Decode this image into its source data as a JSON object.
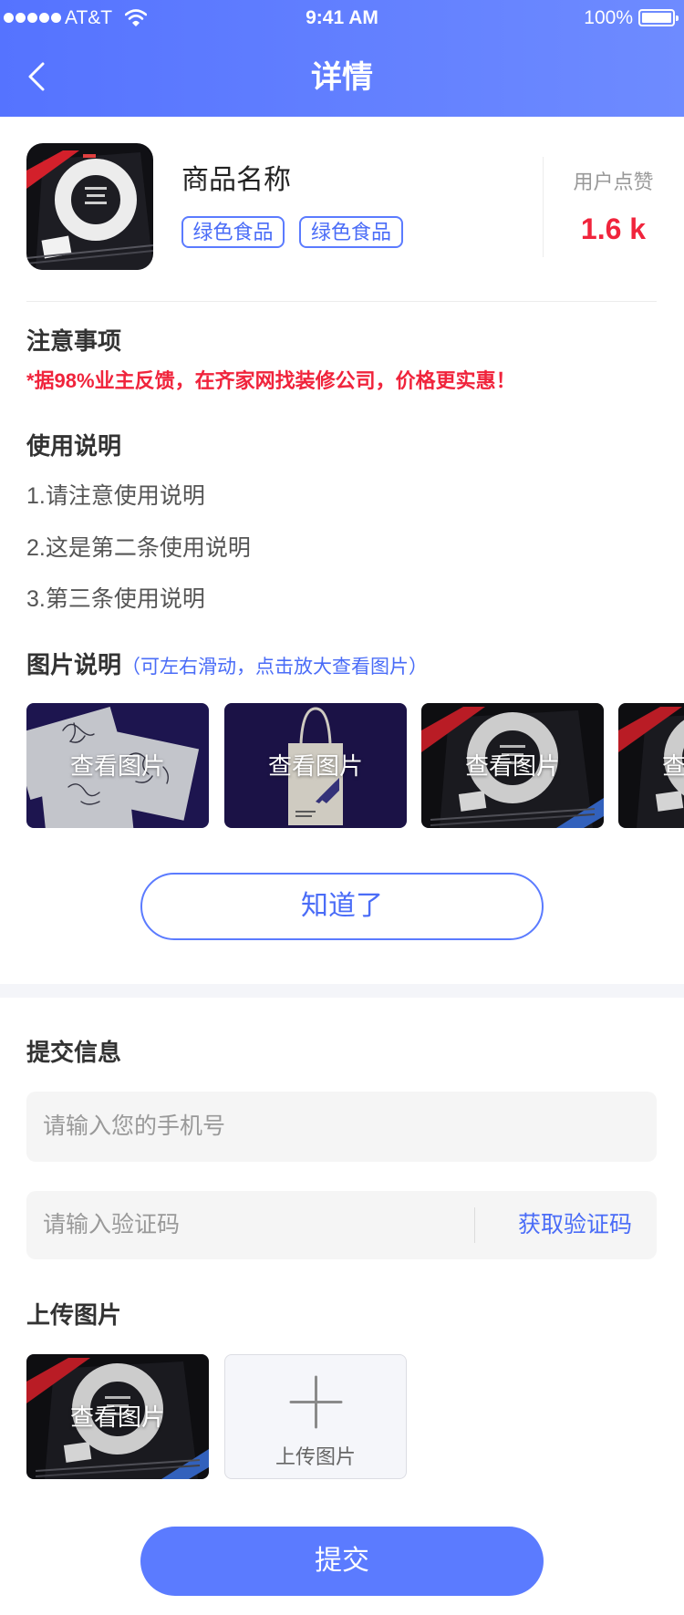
{
  "status_bar": {
    "carrier": "AT&T",
    "signal_bars": 5,
    "wifi_icon": "wifi-icon",
    "time": "9:41 AM",
    "battery_text": "100%",
    "battery_level": 1.0
  },
  "nav": {
    "back_icon": "chevron-left-icon",
    "title": "详情"
  },
  "product": {
    "image": "book-cover",
    "name": "商品名称",
    "tags": [
      "绿色食品",
      "绿色食品"
    ],
    "likes_label": "用户点赞",
    "likes_value": "1.6 k"
  },
  "notice": {
    "heading": "注意事项",
    "text": "*据98%业主反馈，在齐家网找装修公司，价格更实惠！"
  },
  "usage": {
    "heading": "使用说明",
    "items": [
      "1.请注意使用说明",
      "2.这是第二条使用说明",
      "3.第三条使用说明"
    ]
  },
  "gallery": {
    "heading": "图片说明",
    "hint": "（可左右滑动，点击放大查看图片）",
    "items": [
      {
        "image": "sketch-cards",
        "caption": "查看图片"
      },
      {
        "image": "tote-bag",
        "caption": "查看图片"
      },
      {
        "image": "book-cover",
        "caption": "查看图片"
      },
      {
        "image": "book-cover",
        "caption": "查看图片"
      }
    ]
  },
  "confirm_button": "知道了",
  "form": {
    "heading": "提交信息",
    "phone_placeholder": "请输入您的手机号",
    "code_placeholder": "请输入验证码",
    "get_code": "获取验证码",
    "upload_heading": "上传图片",
    "uploads": [
      {
        "image": "book-cover",
        "caption": "查看图片"
      }
    ],
    "upload_icon": "plus-icon",
    "upload_button": "上传图片",
    "submit": "提交"
  },
  "colors": {
    "primary": "#5b7bff",
    "link_blue": "#4a6cf7",
    "accent_red": "#f0243c",
    "header_start": "#5573ff",
    "header_end": "#6e8bff"
  }
}
